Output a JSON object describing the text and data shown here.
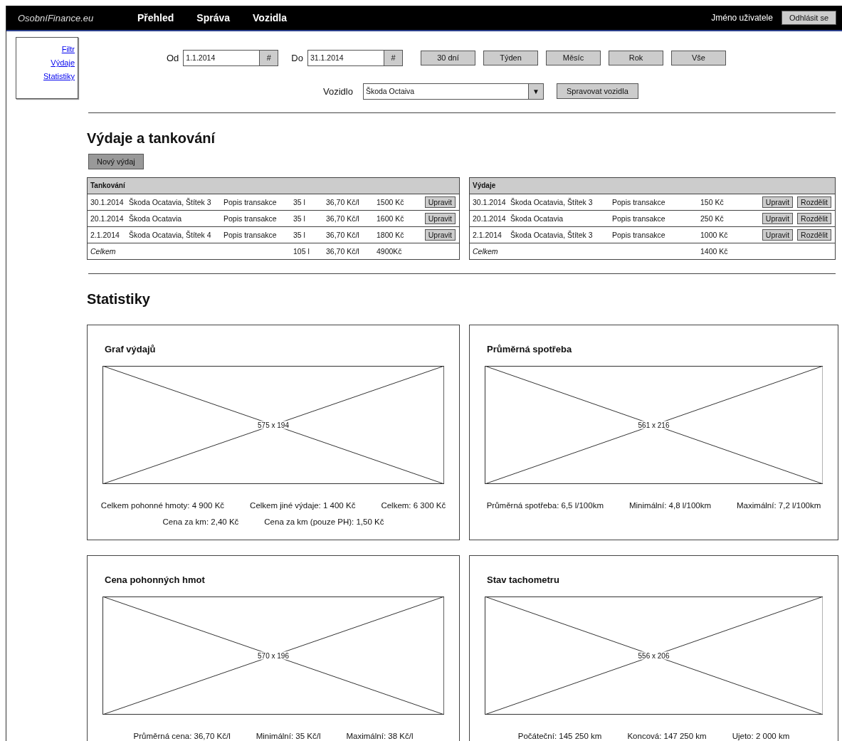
{
  "topbar": {
    "logo": "OsobníFinance.eu",
    "nav": [
      {
        "label": "Přehled"
      },
      {
        "label": "Správa"
      },
      {
        "label": "Vozidla"
      }
    ],
    "user": "Jméno uživatele",
    "logout": "Odhlásit se"
  },
  "sidebar": {
    "links": [
      "Filtr",
      "Výdaje",
      "Statistiky"
    ]
  },
  "filter": {
    "from_label": "Od",
    "from_value": "1.1.2014",
    "to_label": "Do",
    "to_value": "31.1.2014",
    "picker": "#",
    "ranges": [
      "30 dní",
      "Týden",
      "Měsíc",
      "Rok",
      "Vše"
    ],
    "vehicle_label": "Vozidlo",
    "vehicle_value": "Škoda Octaiva",
    "dropdown_arrow": "▼",
    "manage_button": "Spravovat vozidla"
  },
  "expenses": {
    "title": "Výdaje a tankování",
    "new_button": "Nový výdaj"
  },
  "tables": [
    {
      "kind": "fuel",
      "title": "Tankování",
      "rows": [
        {
          "cells": [
            "30.1.2014",
            "Škoda Ocatavia, Štítek 3",
            "Popis transakce",
            "35 l",
            "36,70 Kč/l",
            "1500 Kč"
          ],
          "buttons": [
            "Upravit"
          ]
        },
        {
          "cells": [
            "20.1.2014",
            "Škoda Ocatavia",
            "Popis transakce",
            "35 l",
            "36,70 Kč/l",
            "1600 Kč"
          ],
          "buttons": [
            "Upravit"
          ]
        },
        {
          "cells": [
            "2.1.2014",
            "Škoda Ocatavia, Štítek 4",
            "Popis transakce",
            "35 l",
            "36,70 Kč/l",
            "1800 Kč"
          ],
          "buttons": [
            "Upravit"
          ]
        }
      ],
      "total": {
        "label": "Celkem",
        "values": [
          "105 l",
          "36,70 Kč/l",
          "4900Kč"
        ]
      }
    },
    {
      "kind": "expense",
      "title": "Výdaje",
      "rows": [
        {
          "cells": [
            "30.1.2014",
            "Škoda Ocatavia, Štítek 3",
            "Popis transakce",
            "150 Kč"
          ],
          "buttons": [
            "Upravit",
            "Rozdělit"
          ]
        },
        {
          "cells": [
            "20.1.2014",
            "Škoda Ocatavia",
            "Popis transakce",
            "250 Kč"
          ],
          "buttons": [
            "Upravit",
            "Rozdělit"
          ]
        },
        {
          "cells": [
            "2.1.2014",
            "Škoda Ocatavia, Štítek 3",
            "Popis transakce",
            "1000 Kč"
          ],
          "buttons": [
            "Upravit",
            "Rozdělit"
          ]
        }
      ],
      "total": {
        "label": "Celkem",
        "values": [
          "1400 Kč"
        ]
      }
    }
  ],
  "statistics": {
    "title": "Statistiky",
    "cards": [
      {
        "title": "Graf výdajů",
        "placeholder_label": "575 x 194",
        "stats": [
          [
            "Celkem pohonné hmoty: 4 900 Kč",
            "Celkem jiné výdaje: 1 400 Kč",
            "Celkem: 6 300 Kč"
          ],
          [
            "Cena za km: 2,40 Kč",
            "Cena za km (pouze PH): 1,50 Kč"
          ]
        ]
      },
      {
        "title": "Průměrná spotřeba",
        "placeholder_label": "561 x 216",
        "stats": [
          [
            "Průměrná spotřeba: 6,5 l/100km",
            "Minimální: 4,8 l/100km",
            "Maximální: 7,2 l/100km"
          ]
        ]
      },
      {
        "title": "Cena pohonných hmot",
        "placeholder_label": "570 x 196",
        "stats": [
          [
            "Průměrná cena: 36,70 Kč/l",
            "Minimální: 35 Kč/l",
            "Maximální: 38 Kč/l"
          ]
        ]
      },
      {
        "title": "Stav tachometru",
        "placeholder_label": "556 x 206",
        "stats": [
          [
            "Počáteční: 145 250 km",
            "Koncová: 147 250 km",
            "Ujeto: 2 000 km"
          ]
        ]
      }
    ]
  }
}
